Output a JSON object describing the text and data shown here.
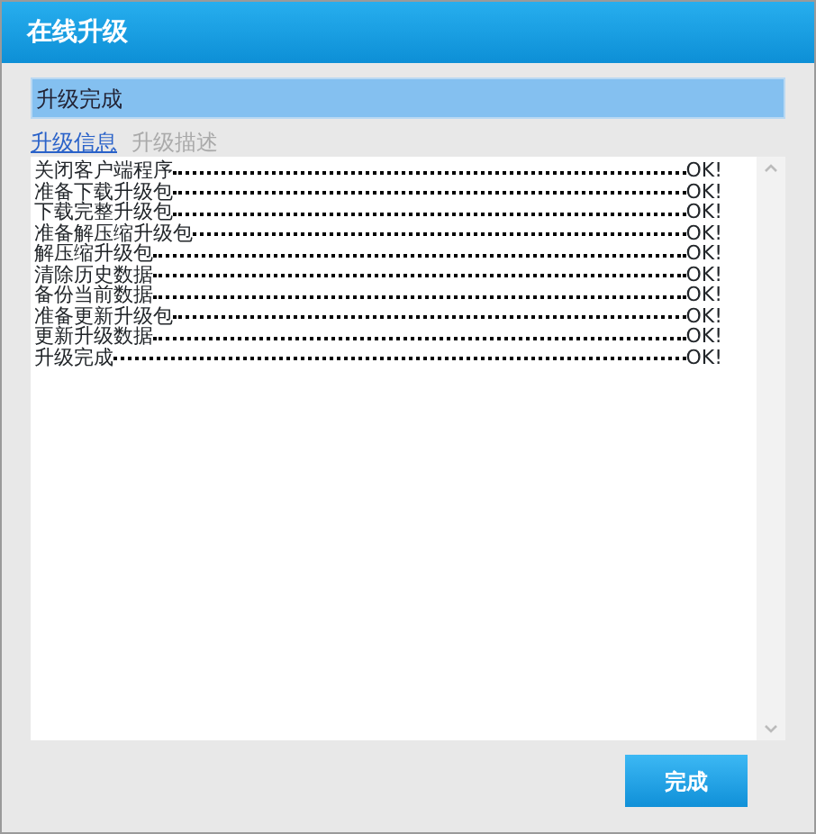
{
  "window": {
    "title": "在线升级"
  },
  "status": "升级完成",
  "tabs": [
    {
      "label": "升级信息",
      "selected": true
    },
    {
      "label": "升级描述",
      "selected": false
    }
  ],
  "log": [
    {
      "step": "关闭客户端程序",
      "result": "OK!"
    },
    {
      "step": "准备下载升级包",
      "result": "OK!"
    },
    {
      "step": "下载完整升级包",
      "result": "OK!"
    },
    {
      "step": "准备解压缩升级包",
      "result": "OK!"
    },
    {
      "step": "解压缩升级包",
      "result": "OK!"
    },
    {
      "step": "清除历史数据",
      "result": "OK!"
    },
    {
      "step": "备份当前数据",
      "result": "OK!"
    },
    {
      "step": "准备更新升级包",
      "result": "OK!"
    },
    {
      "step": "更新升级数据",
      "result": "OK!"
    },
    {
      "step": "升级完成",
      "result": "OK!"
    }
  ],
  "buttons": [
    "完成"
  ]
}
